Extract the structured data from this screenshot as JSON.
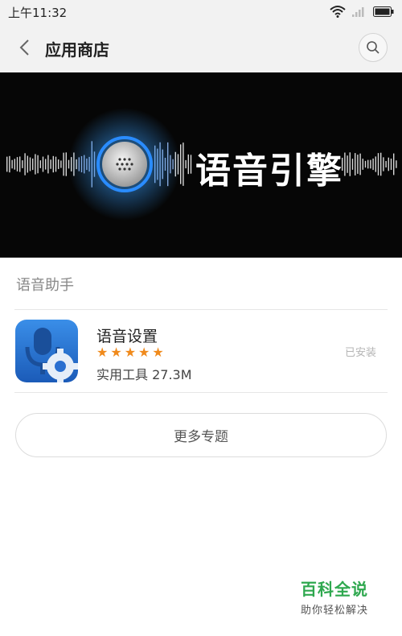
{
  "status_bar": {
    "time": "上午11:32",
    "icons": [
      "wifi-icon",
      "signal-icon",
      "battery-icon"
    ]
  },
  "header": {
    "title": "应用商店",
    "back_icon": "chevron-left-icon",
    "search_icon": "search-icon"
  },
  "banner": {
    "text": "语音引擎"
  },
  "section": {
    "title": "语音助手"
  },
  "app": {
    "name": "语音设置",
    "rating": 5,
    "rating_max": 5,
    "category": "实用工具",
    "size": "27.3M",
    "meta": "实用工具 27.3M",
    "status": "已安装",
    "icon": "microphone-gear-icon"
  },
  "more_button": {
    "label": "更多专题"
  },
  "watermark": {
    "title": "百科全说",
    "subtitle": "助你轻松解决"
  },
  "colors": {
    "star": "#f08a1c",
    "accent_blue": "#1e6fd0",
    "watermark_green": "#2fa84f"
  }
}
